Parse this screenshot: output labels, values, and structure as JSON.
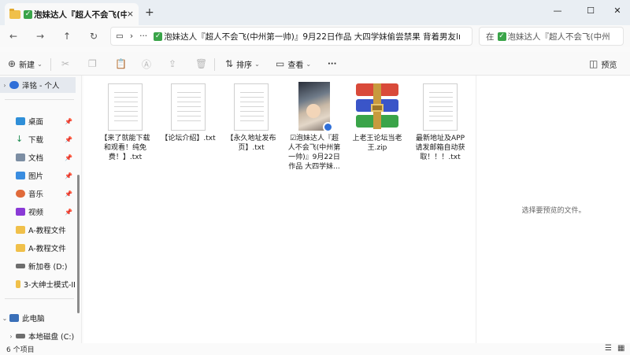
{
  "tab": {
    "title": "泡妹达人『超人不会飞(中州",
    "close": "×",
    "new": "+"
  },
  "window_controls": {
    "minimize": "—",
    "maximize": "☐",
    "close": "✕"
  },
  "nav": {
    "back": "←",
    "forward": "→",
    "up": "↑",
    "refresh": "↻",
    "monitor": "▭",
    "chevron": "›",
    "more": "···"
  },
  "address": {
    "path": "泡妹达人『超人不会飞(中州第一帅)』9月22日作品 大四学妹偷尝禁果 背着男友lı"
  },
  "search": {
    "prefix": "在",
    "path": "泡妹达人『超人不会飞(中州"
  },
  "toolbar": {
    "new_label": "新建",
    "new_icon": "plus-circle-icon",
    "sort_label": "排序",
    "view_label": "查看",
    "more_label": "···",
    "preview_label": "预览"
  },
  "sidebar": {
    "top": {
      "label": "泽铭 - 个人"
    },
    "pinned": [
      {
        "label": "桌面",
        "color": "#2f8fd8"
      },
      {
        "label": "下载",
        "color": "#1b8a4f"
      },
      {
        "label": "文档",
        "color": "#7c8ea3"
      },
      {
        "label": "图片",
        "color": "#3a8de0"
      },
      {
        "label": "音乐",
        "color": "#e06a3a"
      },
      {
        "label": "视频",
        "color": "#8a3ad6"
      }
    ],
    "folders": [
      {
        "label": "A-教程文件"
      },
      {
        "label": "A-教程文件"
      },
      {
        "label": "新加卷 (D:)"
      },
      {
        "label": "3-大绅士模式-II"
      }
    ],
    "this_pc": {
      "label": "此电脑"
    },
    "local_disk": {
      "label": "本地磁盘 (C:)"
    }
  },
  "files": [
    {
      "name": "【来了就能下载和观看！纯免费！】.txt",
      "kind": "txt"
    },
    {
      "name": "【论坛介绍】.txt",
      "kind": "txt"
    },
    {
      "name": "【永久地址发布页】.txt",
      "kind": "txt"
    },
    {
      "name": "泡妹达人『超人不会飞(中州第一帅)』9月22日作品 大四学妹...",
      "kind": "video",
      "check": "☑"
    },
    {
      "name": "上老王论坛当老王.zip",
      "kind": "zip"
    },
    {
      "name": "最新地址及APP请发邮箱自动获取！！！.txt",
      "kind": "txt"
    }
  ],
  "preview": {
    "empty_text": "选择要预览的文件。"
  },
  "status": {
    "count": "6 个项目"
  }
}
